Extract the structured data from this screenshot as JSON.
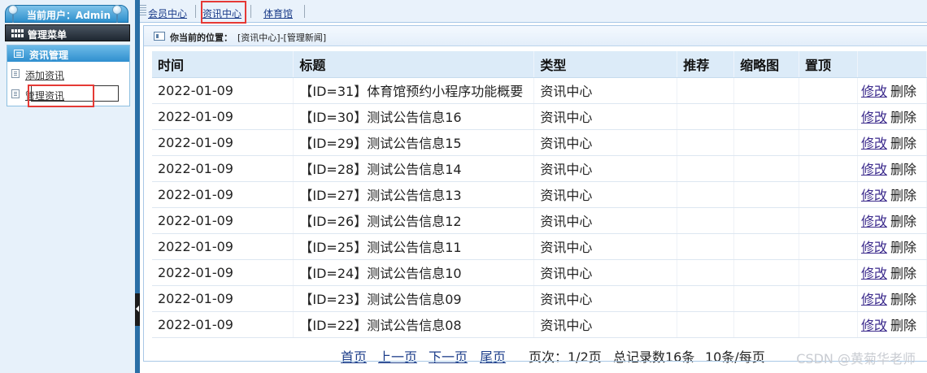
{
  "sidebar": {
    "current_user": "当前用户：Admin",
    "menu_title": "管理菜单",
    "group_title": "资讯管理",
    "items": [
      {
        "label": "添加资讯"
      },
      {
        "label": "管理资讯"
      }
    ]
  },
  "topnav": {
    "links": [
      {
        "label": "会员中心"
      },
      {
        "label": "资讯中心"
      },
      {
        "label": "体育馆"
      }
    ]
  },
  "location": {
    "label": "你当前的位置：",
    "path": "[资讯中心]-[管理新闻]"
  },
  "table": {
    "headers": [
      "时间",
      "标题",
      "类型",
      "推荐",
      "缩略图",
      "置顶",
      ""
    ],
    "edit_label": "修改",
    "delete_label": "删除",
    "rows": [
      {
        "date": "2022-01-09",
        "title": "【ID=31】体育馆预约小程序功能概要",
        "type": "资讯中心"
      },
      {
        "date": "2022-01-09",
        "title": "【ID=30】测试公告信息16",
        "type": "资讯中心"
      },
      {
        "date": "2022-01-09",
        "title": "【ID=29】测试公告信息15",
        "type": "资讯中心"
      },
      {
        "date": "2022-01-09",
        "title": "【ID=28】测试公告信息14",
        "type": "资讯中心"
      },
      {
        "date": "2022-01-09",
        "title": "【ID=27】测试公告信息13",
        "type": "资讯中心"
      },
      {
        "date": "2022-01-09",
        "title": "【ID=26】测试公告信息12",
        "type": "资讯中心"
      },
      {
        "date": "2022-01-09",
        "title": "【ID=25】测试公告信息11",
        "type": "资讯中心"
      },
      {
        "date": "2022-01-09",
        "title": "【ID=24】测试公告信息10",
        "type": "资讯中心"
      },
      {
        "date": "2022-01-09",
        "title": "【ID=23】测试公告信息09",
        "type": "资讯中心"
      },
      {
        "date": "2022-01-09",
        "title": "【ID=22】测试公告信息08",
        "type": "资讯中心"
      }
    ]
  },
  "pager": {
    "first": "首页",
    "prev": "上一页",
    "next": "下一页",
    "last": "尾页",
    "page_info": "页次：1/2页",
    "total_info": "总记录数16条",
    "per_page_info": "10条/每页"
  },
  "watermark": "CSDN @黄菊华老师",
  "colors": {
    "accent_red": "#e53935",
    "nav_blue": "#2a6fa6",
    "header_bg": "#dcebf8"
  }
}
